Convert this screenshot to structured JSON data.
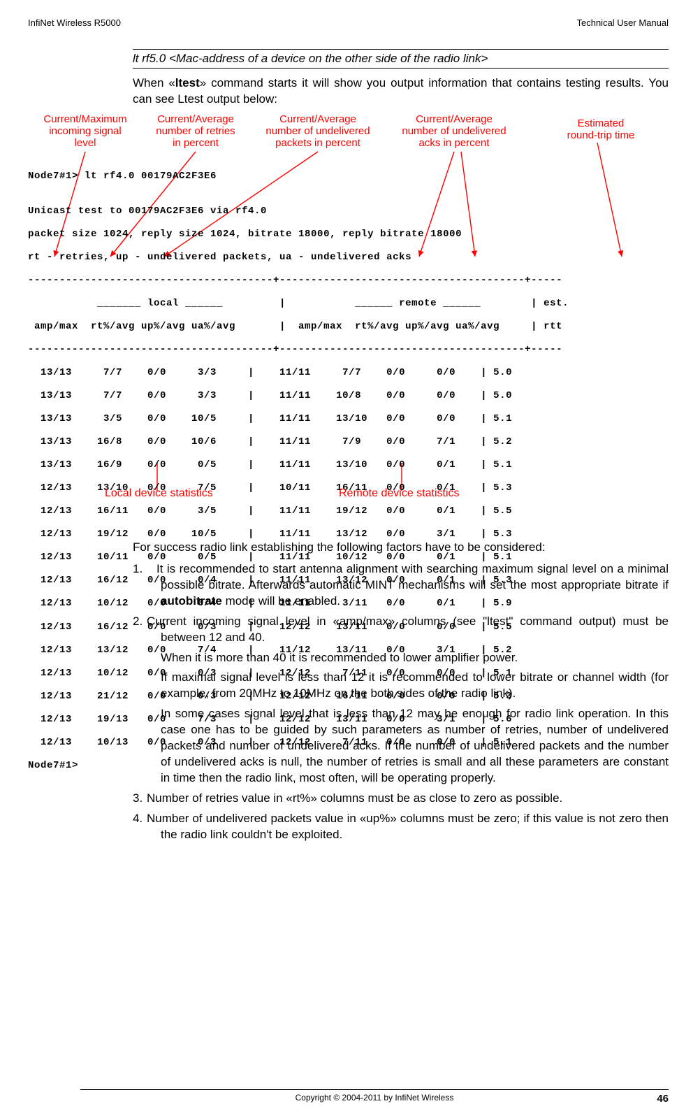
{
  "header": {
    "left": "InfiNet Wireless R5000",
    "right": "Technical User Manual"
  },
  "italic_line": "lt rf5.0 <Mac-address of a device on the other side of the radio link>",
  "intro_para_pre": "When «",
  "intro_bold": "ltest",
  "intro_para_post": "» command starts it will show you output information that contains testing results. You can see Ltest output below:",
  "annotations": {
    "a1_l1": "Current/Maximum",
    "a1_l2": "incoming signal",
    "a1_l3": "level",
    "a2_l1": "Current/Average",
    "a2_l2": "number of retries",
    "a2_l3": "in percent",
    "a3_l1": "Current/Average",
    "a3_l2": "number of undelivered",
    "a3_l3": "packets in percent",
    "a4_l1": "Current/Average",
    "a4_l2": "number of undelivered",
    "a4_l3": "acks in percent",
    "a5_l1": "Estimated",
    "a5_l2": "round-trip time",
    "local": "Local device statistics",
    "remote": "Remote device statistics"
  },
  "terminal": {
    "l1": "Node7#1> lt rf4.0 00179AC2F3E6",
    "l2": "",
    "l3": "Unicast test to 00179AC2F3E6 via rf4.0",
    "l4": "packet size 1024, reply size 1024, bitrate 18000, reply bitrate 18000",
    "l5": "rt - retries, up - undelivered packets, ua - undelivered acks",
    "l6": "---------------------------------------+---------------------------------------+-----",
    "l7": "           _______ local ______         |           ______ remote ______        | est.",
    "l8": " amp/max  rt%/avg up%/avg ua%/avg       |  amp/max  rt%/avg up%/avg ua%/avg     | rtt",
    "l9": "---------------------------------------+---------------------------------------+-----",
    "r1": "  13/13     7/7    0/0     3/3     |    11/11     7/7    0/0     0/0    | 5.0",
    "r2": "  13/13     7/7    0/0     3/3     |    11/11    10/8    0/0     0/0    | 5.0",
    "r3": "  13/13     3/5    0/0    10/5     |    11/11    13/10   0/0     0/0    | 5.1",
    "r4": "  13/13    16/8    0/0    10/6     |    11/11     7/9    0/0     7/1    | 5.2",
    "r5": "  13/13    16/9    0/0     0/5     |    11/11    13/10   0/0     0/1    | 5.1",
    "r6": "  12/13    13/10   0/0     7/5     |    10/11    16/11   0/0     0/1    | 5.3",
    "r7": "  12/13    16/11   0/0     3/5     |    11/11    19/12   0/0     0/1    | 5.5",
    "r8": "  12/13    19/12   0/0    10/5     |    11/11    13/12   0/0     3/1    | 5.3",
    "r9": "  12/13    10/11   0/0     0/5     |    11/11    10/12   0/0     0/1    | 5.1",
    "r10": "  12/13    16/12   0/0     0/4     |    11/11    13/12   0/0     0/1    | 5.3",
    "r11": "  12/13    10/12   0/0     0/4     |    11/11     3/11   0/0     0/1    | 5.9",
    "r12": "  12/13    16/12   0/0     0/3     |    12/12    13/11   0/0     0/0    | 5.5",
    "r13": "  12/13    13/12   0/0     7/4     |    11/12    13/11   0/0     3/1    | 5.2",
    "r14": "  12/13    10/12   0/0     0/3     |    12/12     7/11   0/0     0/0    | 5.1",
    "r15": "  12/13    21/12   0/0     0/3     |    12/12    16/11   0/0     0/0    | 5.3",
    "r16": "  12/13    19/13   0/0     7/3     |    12/12    13/11   0/0     3/1    | 5.6",
    "r17": "  12/13    10/13   0/0     0/3     |    12/12     7/11   0/0     0/0    | 5.1",
    "r18": "Node7#1>"
  },
  "after_para": "For success radio link establishing the following factors have to be considered:",
  "list": {
    "n1": "1.",
    "p1_a": "It is recommended to start antenna alignment with searching maximum signal level on a minimal possible bitrate.  Afterwards automatic MINT mechanisms will set the most appropriate bitrate if ",
    "p1_bold": "autobitrate",
    "p1_b": " mode will be enabled.",
    "n2": "2.",
    "p2": "Current incoming signal level in «amp/max» columns (see \"ltest\" command output) must be between 12 and 40.",
    "p2b": "When it is more than 40 it is recommended to lower amplifier power.",
    "p2c": "If maximal signal level is less than 12 it is recommended to lower bitrate or channel width (for example, from 20MHz to 10MHz on the both sides of the radio link).",
    "p2d": "In some cases signal level that is less than 12 may be enough for radio link operation. In this case one has to be guided by such parameters as number of retries, number of undelivered packets and number of undelivered acks. If the number of undelivered packets and the number of undelivered acks is null, the number of retries is small and all these parameters are constant in time then the radio link, most often, will be operating properly.",
    "n3": "3.",
    "p3": "Number of retries value in «rt%» columns must be as close to zero as possible.",
    "n4": "4.",
    "p4": "Number of undelivered packets value in «up%» columns must be zero; if this value is not zero then the radio link couldn't be exploited."
  },
  "footer": {
    "center": "Copyright © 2004-2011 by InfiNet Wireless",
    "page": "46"
  }
}
